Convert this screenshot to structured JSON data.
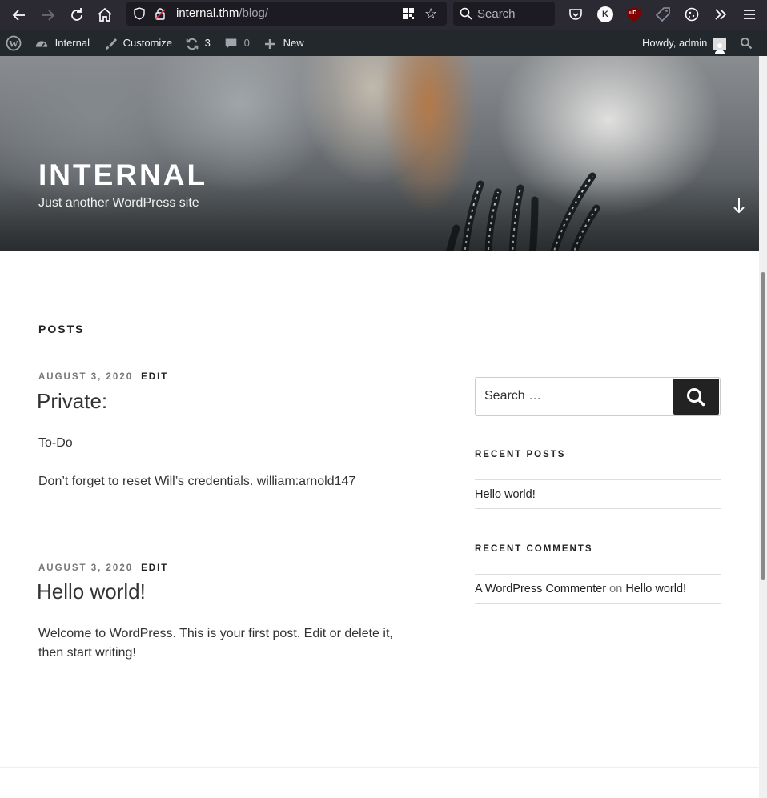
{
  "browser": {
    "url_host": "internal.thm",
    "url_path": "/blog/",
    "search_placeholder": "Search",
    "ext_k_label": "K",
    "ext_ublock_label": "uD"
  },
  "adminbar": {
    "site_name": "Internal",
    "customize": "Customize",
    "updates_count": "3",
    "comments_count": "0",
    "new_label": "New",
    "howdy": "Howdy, admin"
  },
  "header": {
    "title": "INTERNAL",
    "tagline": "Just another WordPress site"
  },
  "main": {
    "section_heading": "POSTS",
    "posts": [
      {
        "date": "AUGUST 3, 2020",
        "edit": "EDIT",
        "title": "Private:",
        "paragraphs": [
          "To-Do",
          "Don’t forget to reset Will’s credentials. william:arnold147"
        ]
      },
      {
        "date": "AUGUST 3, 2020",
        "edit": "EDIT",
        "title": "Hello world!",
        "paragraphs": [
          "Welcome to WordPress. This is your first post. Edit or delete it, then start writing!"
        ]
      }
    ]
  },
  "sidebar": {
    "search_placeholder": "Search …",
    "recent_posts_title": "RECENT POSTS",
    "recent_posts": [
      "Hello world!"
    ],
    "recent_comments_title": "RECENT COMMENTS",
    "recent_comment": {
      "author": "A WordPress Commenter",
      "on": "on",
      "post": "Hello world!"
    }
  }
}
